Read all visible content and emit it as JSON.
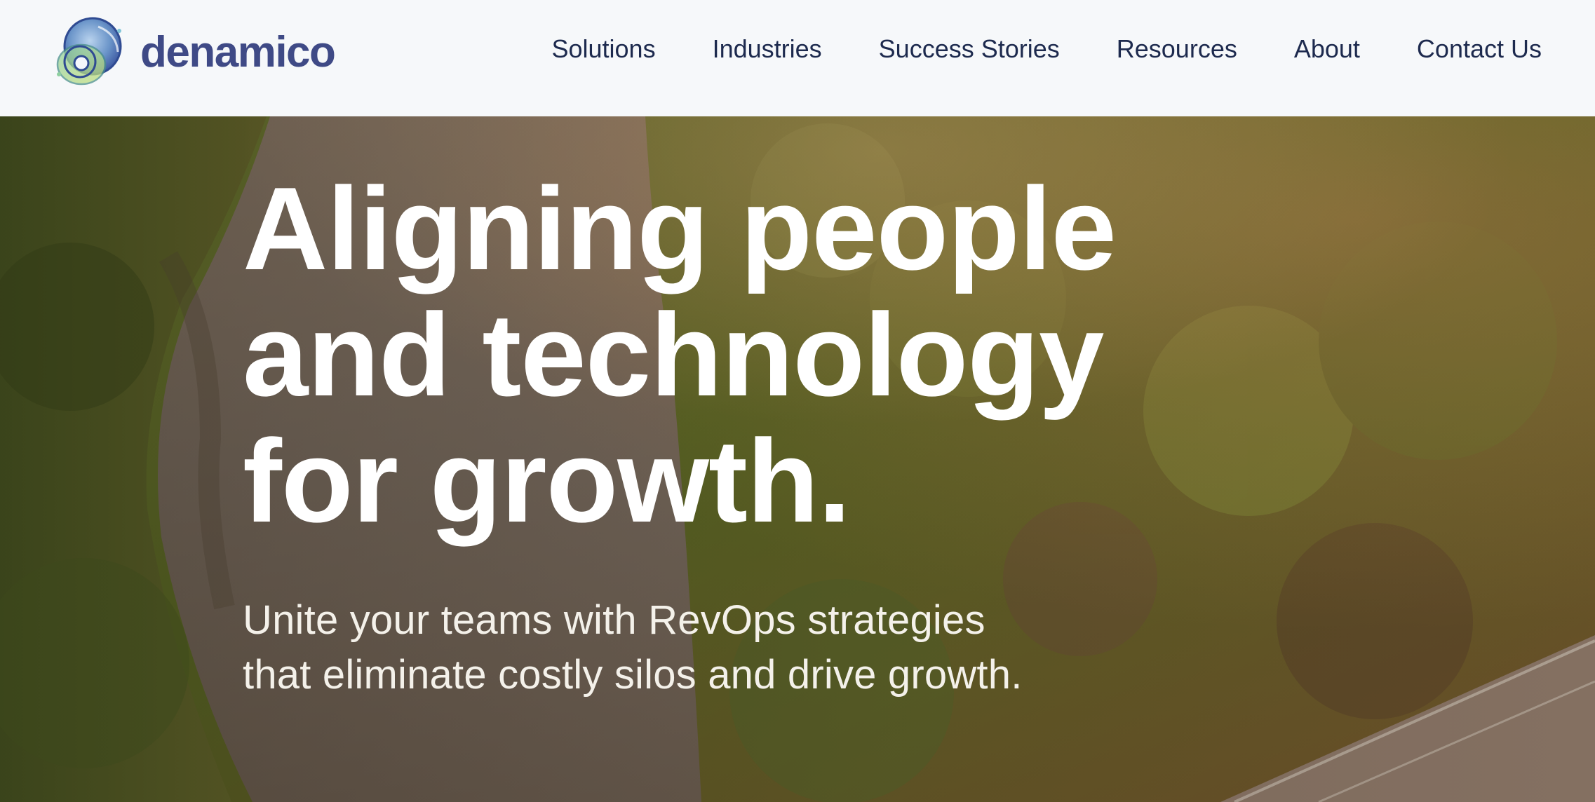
{
  "brand": {
    "name": "denamico",
    "logo_icon": "denamico-circles-logo-icon"
  },
  "nav": {
    "items": [
      {
        "label": "Solutions"
      },
      {
        "label": "Industries"
      },
      {
        "label": "Success Stories"
      },
      {
        "label": "Resources"
      },
      {
        "label": "About"
      },
      {
        "label": "Contact Us"
      }
    ]
  },
  "hero": {
    "title_lines": [
      "Aligning people",
      "and technology",
      "for growth."
    ],
    "subtitle": "Unite your teams with RevOps strategies that eliminate costly silos and drive growth.",
    "background": "aerial-river-forest-photo"
  },
  "colors": {
    "brand_text": "#3f4a86",
    "nav_text": "#1d2a4e",
    "header_bg": "#f6f8fa",
    "hero_text": "#ffffff"
  }
}
